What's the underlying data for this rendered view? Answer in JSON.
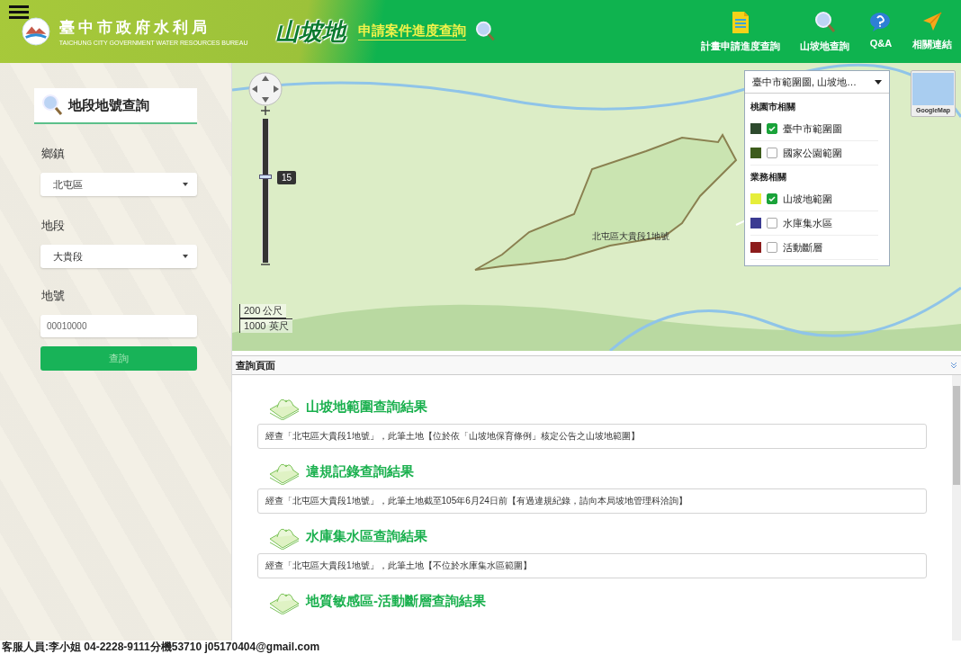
{
  "header": {
    "org_name": "臺中市政府水利局",
    "org_name_en": "TAICHUNG CITY GOVERNMENT WATER RESOURCES BUREAU",
    "brand": "山坡地",
    "subtitle": "申請案件進度查詢",
    "nav": [
      {
        "label": "計畫申請進度查詢",
        "kind": "document"
      },
      {
        "label": "山坡地查詢",
        "kind": "search"
      },
      {
        "label": "Q&A",
        "kind": "help"
      },
      {
        "label": "相關連結",
        "kind": "link"
      }
    ]
  },
  "sidebar": {
    "title": "地段地號查詢",
    "fields": [
      {
        "label": "鄉鎮",
        "kind": "select",
        "value": "北屯區"
      },
      {
        "label": "地段",
        "kind": "select",
        "value": "大貴段"
      },
      {
        "label": "地號",
        "kind": "input",
        "value": "00010000"
      }
    ],
    "button": "查詢"
  },
  "map": {
    "zoom": {
      "level": 0.58,
      "reading": "15"
    },
    "parcel_label": "北屯區大貴段1地號",
    "scale": [
      "200 公尺",
      "1000 英尺"
    ],
    "basemap_button": "GoogleMap",
    "layers": {
      "value": "臺中市範圍圖, 山坡地…",
      "items": [
        {
          "kind": "group",
          "label": "桃園市相關"
        },
        {
          "kind": "layer",
          "label": "臺中市範圍圖",
          "color": "#2e4a2e",
          "checked": true
        },
        {
          "kind": "layer",
          "label": "國家公園範圍",
          "color": "#3d5c1c",
          "checked": false
        },
        {
          "kind": "group",
          "label": "業務相關"
        },
        {
          "kind": "layer",
          "label": "山坡地範圍",
          "color": "#e6ee3a",
          "checked": true
        },
        {
          "kind": "layer",
          "label": "水庫集水區",
          "color": "#3b3b92",
          "checked": false
        },
        {
          "kind": "layer",
          "label": "活動斷層",
          "color": "#8c1c1c",
          "checked": false
        }
      ]
    }
  },
  "results": {
    "title": "查詢頁面",
    "sections": [
      {
        "heading": "山坡地範圍查詢結果",
        "text": "經查「北屯區大貴段1地號」，此筆土地【位於依「山坡地保育條例」核定公告之山坡地範圍】"
      },
      {
        "heading": "違規記錄查詢結果",
        "text": "經查「北屯區大貴段1地號」，此筆土地截至105年6月24日前【有過違規紀錄，請向本局坡地管理科洽詢】"
      },
      {
        "heading": "水庫集水區查詢結果",
        "text": "經查「北屯區大貴段1地號」，此筆土地【不位於水庫集水區範圍】"
      },
      {
        "heading": "地質敏感區-活動斷層查詢結果"
      }
    ]
  },
  "footer": "客服人員:李小姐 04-2228-9111分機53710 j05170404@gmail.com"
}
